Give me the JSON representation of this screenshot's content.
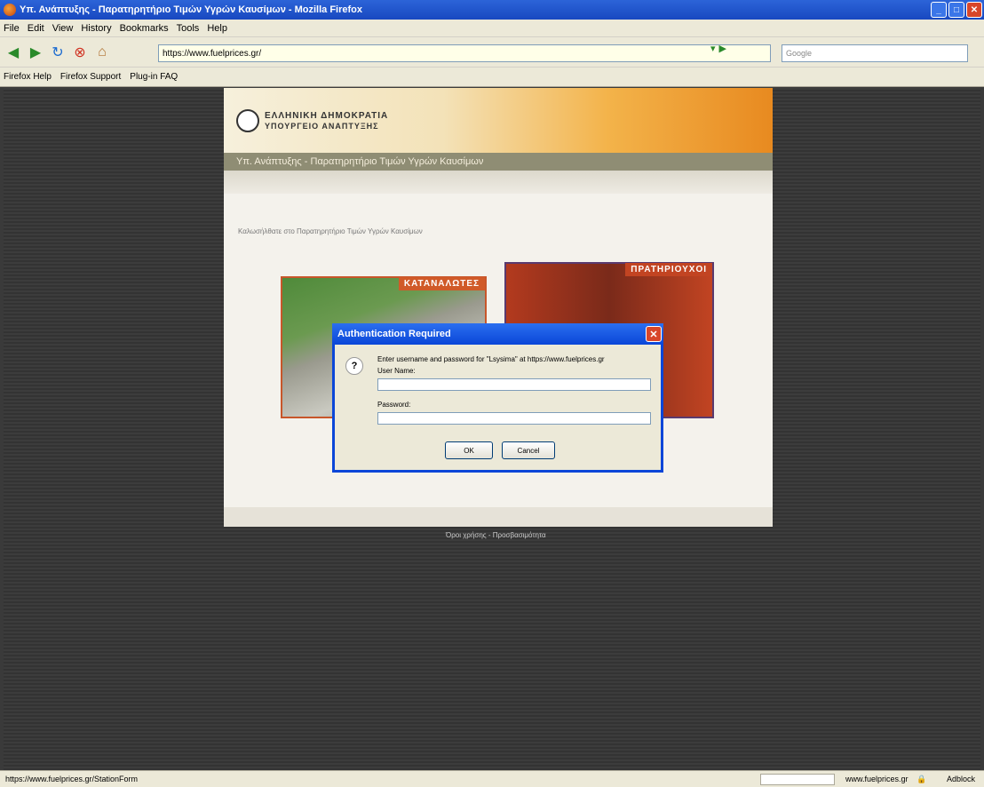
{
  "window": {
    "title": "Υπ. Ανάπτυξης - Παρατηρητήριο Τιμών Υγρών Καυσίμων - Mozilla Firefox"
  },
  "menu": [
    "File",
    "Edit",
    "View",
    "History",
    "Bookmarks",
    "Tools",
    "Help"
  ],
  "nav": {
    "url": "https://www.fuelprices.gr/",
    "search_placeholder": "Google"
  },
  "bookmarks": [
    "Firefox Help",
    "Firefox Support",
    "Plug-in FAQ"
  ],
  "site": {
    "gov_line1": "ΕΛΛΗΝΙΚΗ ΔΗΜΟΚΡΑΤΙΑ",
    "gov_line2": "ΥΠΟΥΡΓΕΙΟ ΑΝΑΠΤΥΞΗΣ",
    "subtitle": "Υπ. Ανάπτυξης - Παρατηρητήριο Τιμών Υγρών Καυσίμων",
    "welcome": "Καλωσήλθατε στο Παρατηρητήριο Τιμών Υγρών Καυσίμων",
    "panel_consumers": "ΚΑΤΑΝΑΛΩΤΕΣ",
    "panel_stations": "ΠΡΑΤΗΡΙΟΥΧΟΙ",
    "footer": "Όροι χρήσης - Προσβασιμότητα"
  },
  "dialog": {
    "title": "Authentication Required",
    "message": "Enter username and password for \"Lsysima\" at https://www.fuelprices.gr",
    "username_label": "User Name:",
    "password_label": "Password:",
    "ok": "OK",
    "cancel": "Cancel"
  },
  "status": {
    "left": "https://www.fuelprices.gr/StationForm",
    "domain": "www.fuelprices.gr",
    "adblock": "Adblock"
  }
}
